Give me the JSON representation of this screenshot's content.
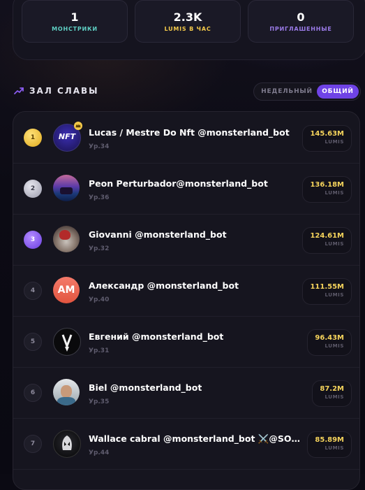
{
  "stats": [
    {
      "value": "1",
      "label": "МОНСТРИКИ",
      "color": "#5fd0c4"
    },
    {
      "value": "2.3K",
      "label": "LUMIS В ЧАС",
      "color": "#f3c94a"
    },
    {
      "value": "0",
      "label": "ПРИГЛАШЕННЫЕ",
      "color": "#9b7be8"
    }
  ],
  "hall_of_fame": {
    "title": "ЗАЛ СЛАВЫ",
    "icon": "trending-up-icon"
  },
  "toggle": {
    "weekly": "НЕДЕЛЬНЫЙ",
    "overall": "ОБЩИЙ"
  },
  "leaderboard": [
    {
      "rank": "1",
      "name": "Lucas / Mestre Do Nft @monsterland_bot",
      "level": "Ур.34",
      "score": "145.63M",
      "unit": "LUMIS"
    },
    {
      "rank": "2",
      "name": "Peon Perturbador@monsterland_bot",
      "level": "Ур.36",
      "score": "136.18M",
      "unit": "LUMIS"
    },
    {
      "rank": "3",
      "name": "Giovanni @monsterland_bot",
      "level": "Ур.32",
      "score": "124.61M",
      "unit": "LUMIS"
    },
    {
      "rank": "4",
      "name": "Александр @monsterland_bot",
      "level": "Ур.40",
      "score": "111.55M",
      "unit": "LUMIS",
      "initials": "AM"
    },
    {
      "rank": "5",
      "name": "Евгений @monsterland_bot",
      "level": "Ур.31",
      "score": "96.43M",
      "unit": "LUMIS"
    },
    {
      "rank": "6",
      "name": "Biel @monsterland_bot",
      "level": "Ур.35",
      "score": "87.2M",
      "unit": "LUMIS"
    },
    {
      "rank": "7",
      "name": "Wallace cabral @monsterland_bot ⚔️@SOUL...",
      "level": "Ур.44",
      "score": "85.89M",
      "unit": "LUMIS"
    }
  ],
  "badges": {
    "first_place_avatar_text": "NFT"
  }
}
